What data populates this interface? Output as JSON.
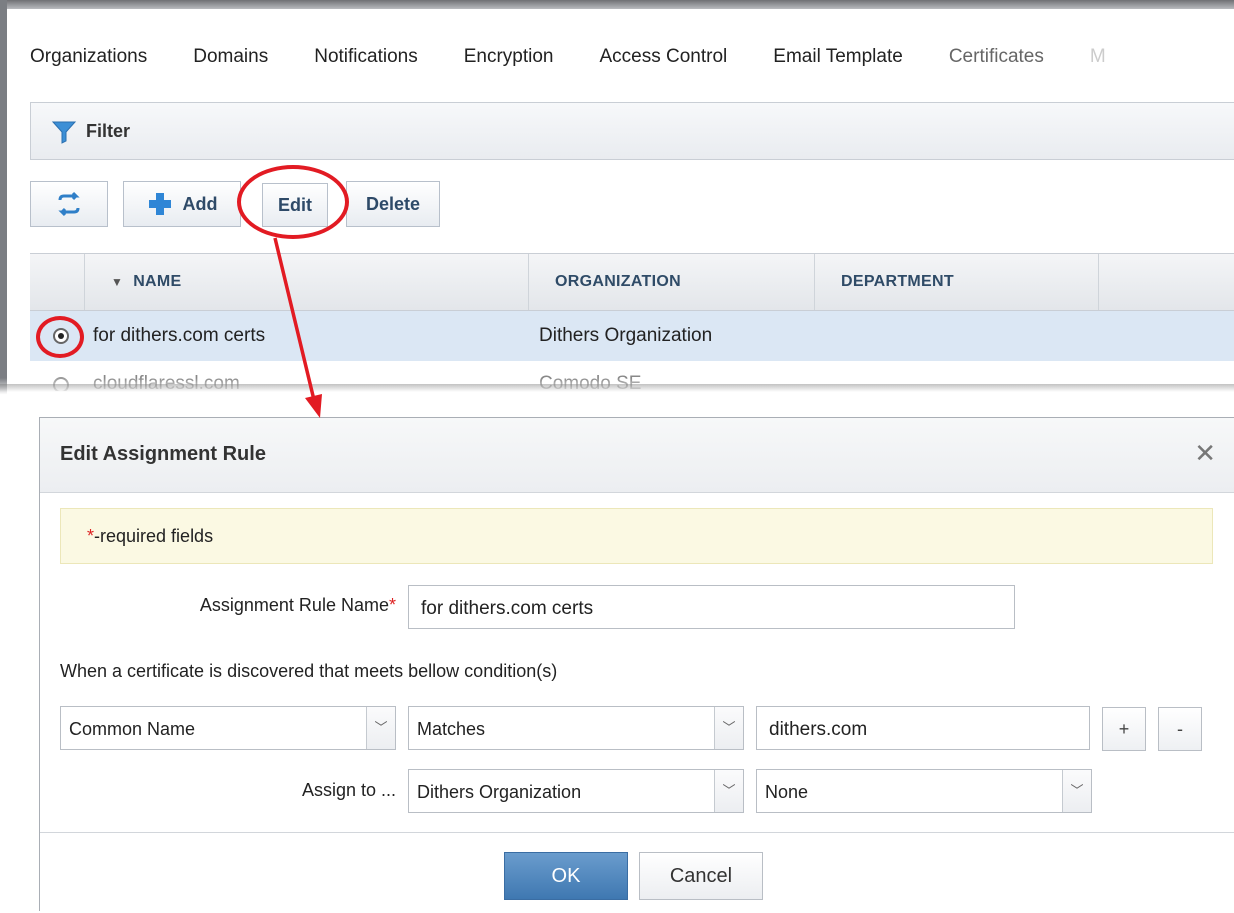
{
  "tabs": [
    {
      "label": "Organizations"
    },
    {
      "label": "Domains"
    },
    {
      "label": "Notifications"
    },
    {
      "label": "Encryption"
    },
    {
      "label": "Access Control"
    },
    {
      "label": "Email Template"
    },
    {
      "label": "Certificates"
    },
    {
      "label": "M"
    }
  ],
  "filter": {
    "label": "Filter"
  },
  "toolbar": {
    "add_label": "Add",
    "edit_label": "Edit",
    "delete_label": "Delete"
  },
  "grid": {
    "columns": [
      "NAME",
      "ORGANIZATION",
      "DEPARTMENT"
    ],
    "rows": [
      {
        "name": "for dithers.com certs",
        "organization": "Dithers Organization",
        "department": "",
        "selected": true
      },
      {
        "name": "cloudflaressl.com",
        "organization": "Comodo SE",
        "department": "",
        "selected": false
      }
    ]
  },
  "dialog": {
    "title": "Edit Assignment Rule",
    "required_note": "-required fields",
    "required_mark": "*",
    "rule_name_label": "Assignment Rule Name",
    "rule_name_value": "for dithers.com certs",
    "condition_text": "When a certificate is discovered that meets bellow condition(s)",
    "condition_field": "Common Name",
    "condition_operator": "Matches",
    "condition_value": "dithers.com",
    "add_condition": "+",
    "remove_condition": "-",
    "assign_label": "Assign to ...",
    "assign_org": "Dithers Organization",
    "assign_dept": "None",
    "ok_label": "OK",
    "cancel_label": "Cancel"
  },
  "colors": {
    "annotation": "#e21b23",
    "accent": "#3f78b1",
    "selected_row": "#dbe7f4"
  }
}
